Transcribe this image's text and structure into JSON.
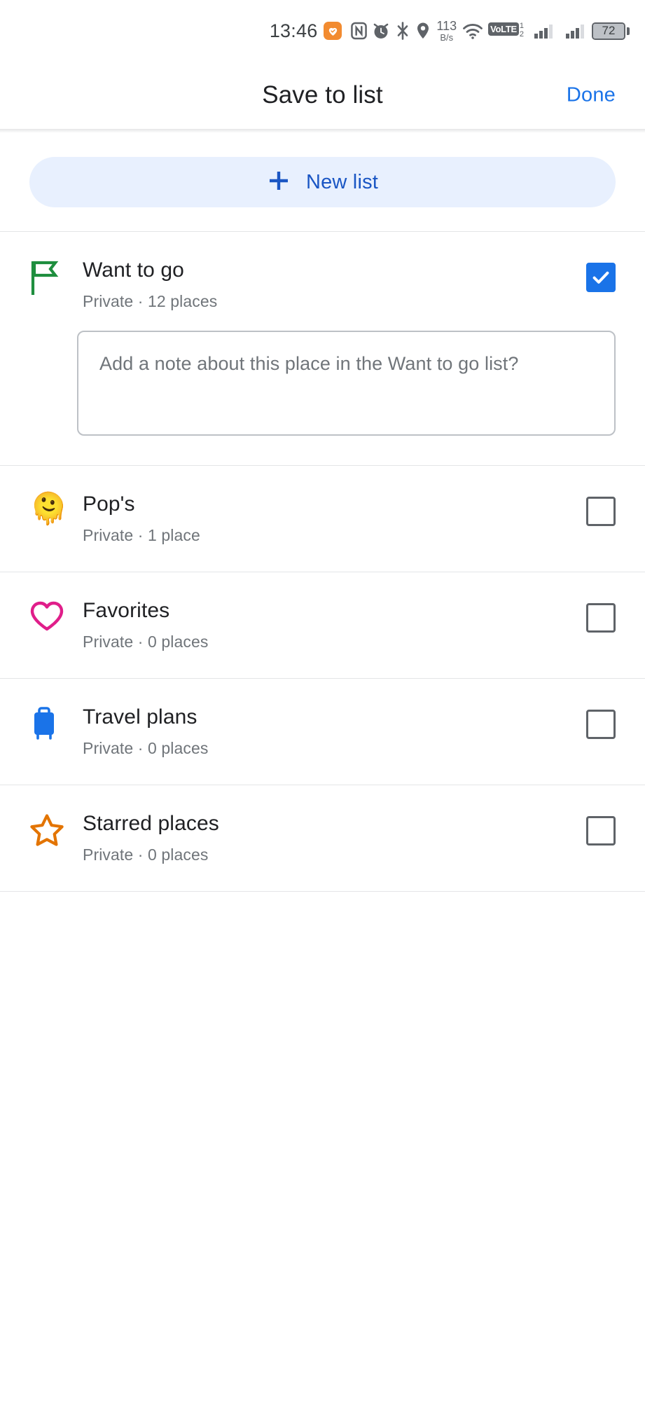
{
  "status_bar": {
    "clock": "13:46",
    "icons": [
      "heart-shield-icon",
      "nfc-icon",
      "alarm-icon",
      "bluetooth-icon",
      "location-icon",
      "wifi-icon",
      "volte-icon",
      "signal-sim1-icon",
      "signal-sim2-icon",
      "battery-icon"
    ],
    "network_speed_value": "113",
    "network_speed_unit": "B/s",
    "volte_label": "VoLTE",
    "sim_indicator_top": "1",
    "sim_indicator_bottom": "2",
    "battery_level": "72"
  },
  "header": {
    "title": "Save to list",
    "action_label": "Done"
  },
  "new_list_button": {
    "label": "New list",
    "icon": "plus-icon",
    "background_color": "#e8f0fe",
    "text_color": "#1a56c4"
  },
  "note_field": {
    "placeholder": "Add a note about this place in the Want to go list?",
    "value": ""
  },
  "lists": [
    {
      "name": "Want to go",
      "subtitle": "Private · 12 places",
      "visibility": "Private",
      "place_count": "12 places",
      "icon": "flag-icon",
      "icon_color": "#1e8e3e",
      "checked": true,
      "has_note_field": true
    },
    {
      "name": "Pop's",
      "subtitle": "Private · 1 place",
      "visibility": "Private",
      "place_count": "1 place",
      "icon": "melting-face-emoji",
      "icon_glyph": "🫠",
      "checked": false,
      "has_note_field": false
    },
    {
      "name": "Favorites",
      "subtitle": "Private · 0 places",
      "visibility": "Private",
      "place_count": "0 places",
      "icon": "heart-icon",
      "icon_color": "#e01e8a",
      "checked": false,
      "has_note_field": false
    },
    {
      "name": "Travel plans",
      "subtitle": "Private · 0 places",
      "visibility": "Private",
      "place_count": "0 places",
      "icon": "suitcase-icon",
      "icon_color": "#1a73e8",
      "checked": false,
      "has_note_field": false
    },
    {
      "name": "Starred places",
      "subtitle": "Private · 0 places",
      "visibility": "Private",
      "place_count": "0 places",
      "icon": "star-icon",
      "icon_color": "#e37400",
      "checked": false,
      "has_note_field": false
    }
  ],
  "colors": {
    "accent_blue": "#1a73e8",
    "text_primary": "#202124",
    "text_secondary": "#70757a",
    "divider": "#e4e5e7"
  }
}
